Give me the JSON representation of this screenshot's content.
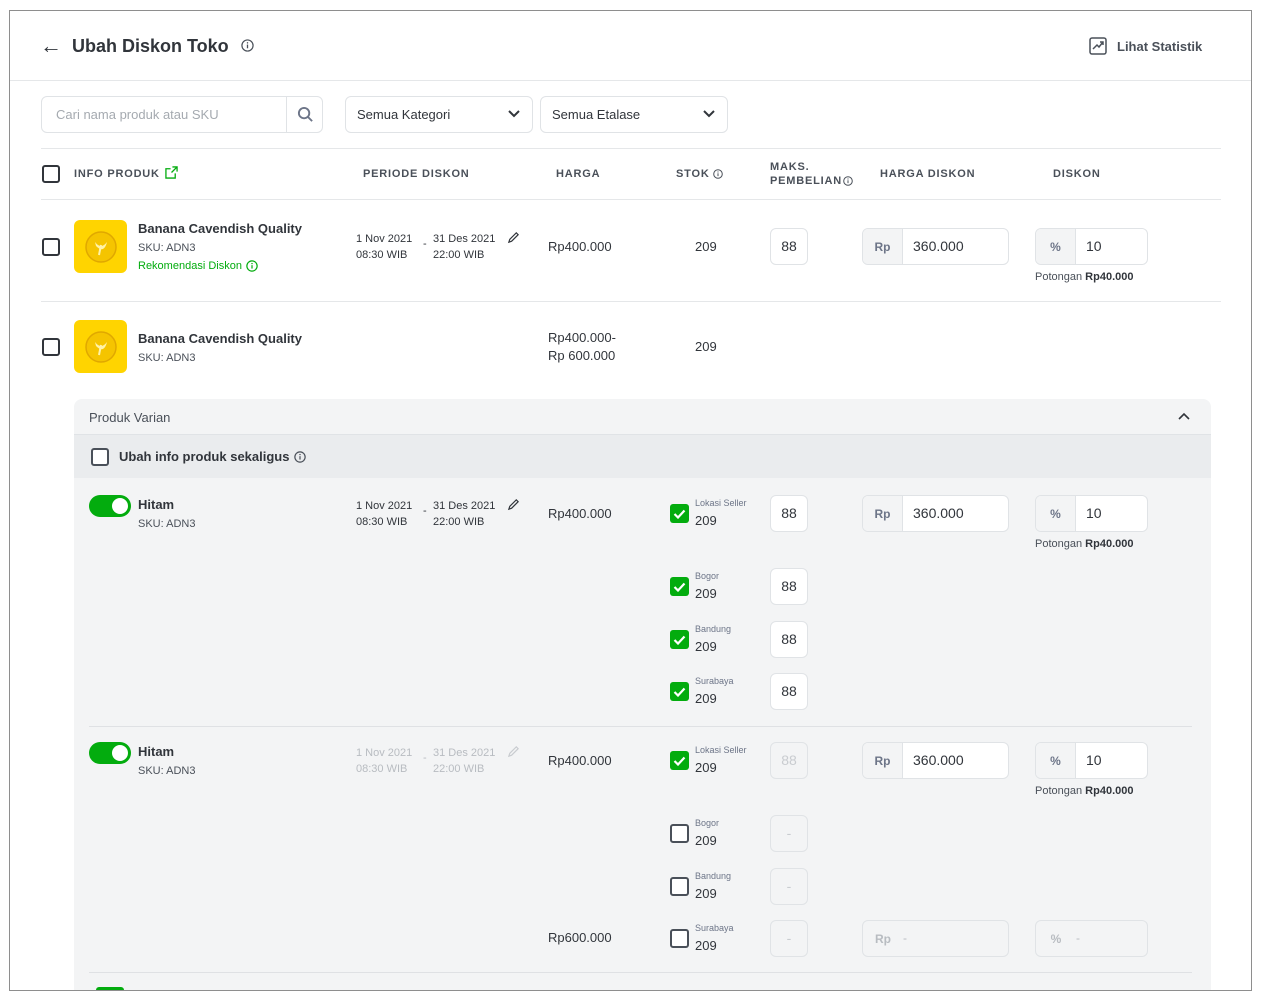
{
  "header": {
    "title": "Ubah Diskon Toko",
    "stat_link": "Lihat Statistik"
  },
  "filters": {
    "search_placeholder": "Cari nama produk atau SKU",
    "category": "Semua Kategori",
    "etalase": "Semua Etalase"
  },
  "columns": {
    "info": "INFO PRODUK",
    "periode": "PERIODE DISKON",
    "harga": "HARGA",
    "stok": "STOK",
    "maks_1": "MAKS.",
    "maks_2": "PEMBELIAN",
    "harga_diskon": "HARGA DISKON",
    "diskon": "DISKON"
  },
  "product1": {
    "name": "Banana Cavendish Quality",
    "sku": "SKU: ADN3",
    "reco": "Rekomendasi Diskon",
    "start_date": "1 Nov 2021",
    "start_time": "08:30 WIB",
    "end_date": "31 Des 2021",
    "end_time": "22:00 WIB",
    "dash": "-",
    "price": "Rp400.000",
    "stock": "209",
    "max": "88",
    "currency": "Rp",
    "disc_price": "360.000",
    "pct_sym": "%",
    "pct": "10",
    "potongan_label": "Potongan",
    "potongan_value": "Rp40.000"
  },
  "product2": {
    "name": "Banana Cavendish Quality",
    "sku": "SKU: ADN3",
    "price_1": "Rp400.000-",
    "price_2": "Rp 600.000",
    "stock": "209"
  },
  "variants": {
    "panel_title": "Produk Varian",
    "bulk_label": "Ubah info produk sekaligus",
    "v1": {
      "name": "Hitam",
      "sku": "SKU: ADN3",
      "start_date": "1 Nov 2021",
      "start_time": "08:30 WIB",
      "end_date": "31 Des 2021",
      "end_time": "22:00 WIB",
      "dash": "-",
      "price": "Rp400.000",
      "currency": "Rp",
      "disc_price": "360.000",
      "pct_sym": "%",
      "pct": "10",
      "potongan_label": "Potongan",
      "potongan_value": "Rp40.000",
      "locations": [
        {
          "label": "Lokasi Seller",
          "stock": "209",
          "max": "88",
          "checked": true
        },
        {
          "label": "Bogor",
          "stock": "209",
          "max": "88",
          "checked": true
        },
        {
          "label": "Bandung",
          "stock": "209",
          "max": "88",
          "checked": true
        },
        {
          "label": "Surabaya",
          "stock": "209",
          "max": "88",
          "checked": true
        }
      ]
    },
    "v2": {
      "name": "Hitam",
      "sku": "SKU: ADN3",
      "start_date": "1 Nov 2021",
      "start_time": "08:30 WIB",
      "end_date": "31 Des 2021",
      "end_time": "22:00 WIB",
      "dash": "-",
      "price": "Rp400.000",
      "price_last": "Rp600.000",
      "currency": "Rp",
      "disc_price": "360.000",
      "pct_sym": "%",
      "pct": "10",
      "potongan_label": "Potongan",
      "potongan_value": "Rp40.000",
      "empty": "-",
      "locations": [
        {
          "label": "Lokasi Seller",
          "stock": "209",
          "max": "88",
          "checked": true
        },
        {
          "label": "Bogor",
          "stock": "209",
          "max": "-",
          "checked": false
        },
        {
          "label": "Bandung",
          "stock": "209",
          "max": "-",
          "checked": false
        },
        {
          "label": "Surabaya",
          "stock": "209",
          "max": "-",
          "checked": false
        }
      ]
    }
  },
  "colors": {
    "primary": "#03ac0e",
    "thumb": "#ffd400",
    "panel": "#f3f4f5"
  }
}
